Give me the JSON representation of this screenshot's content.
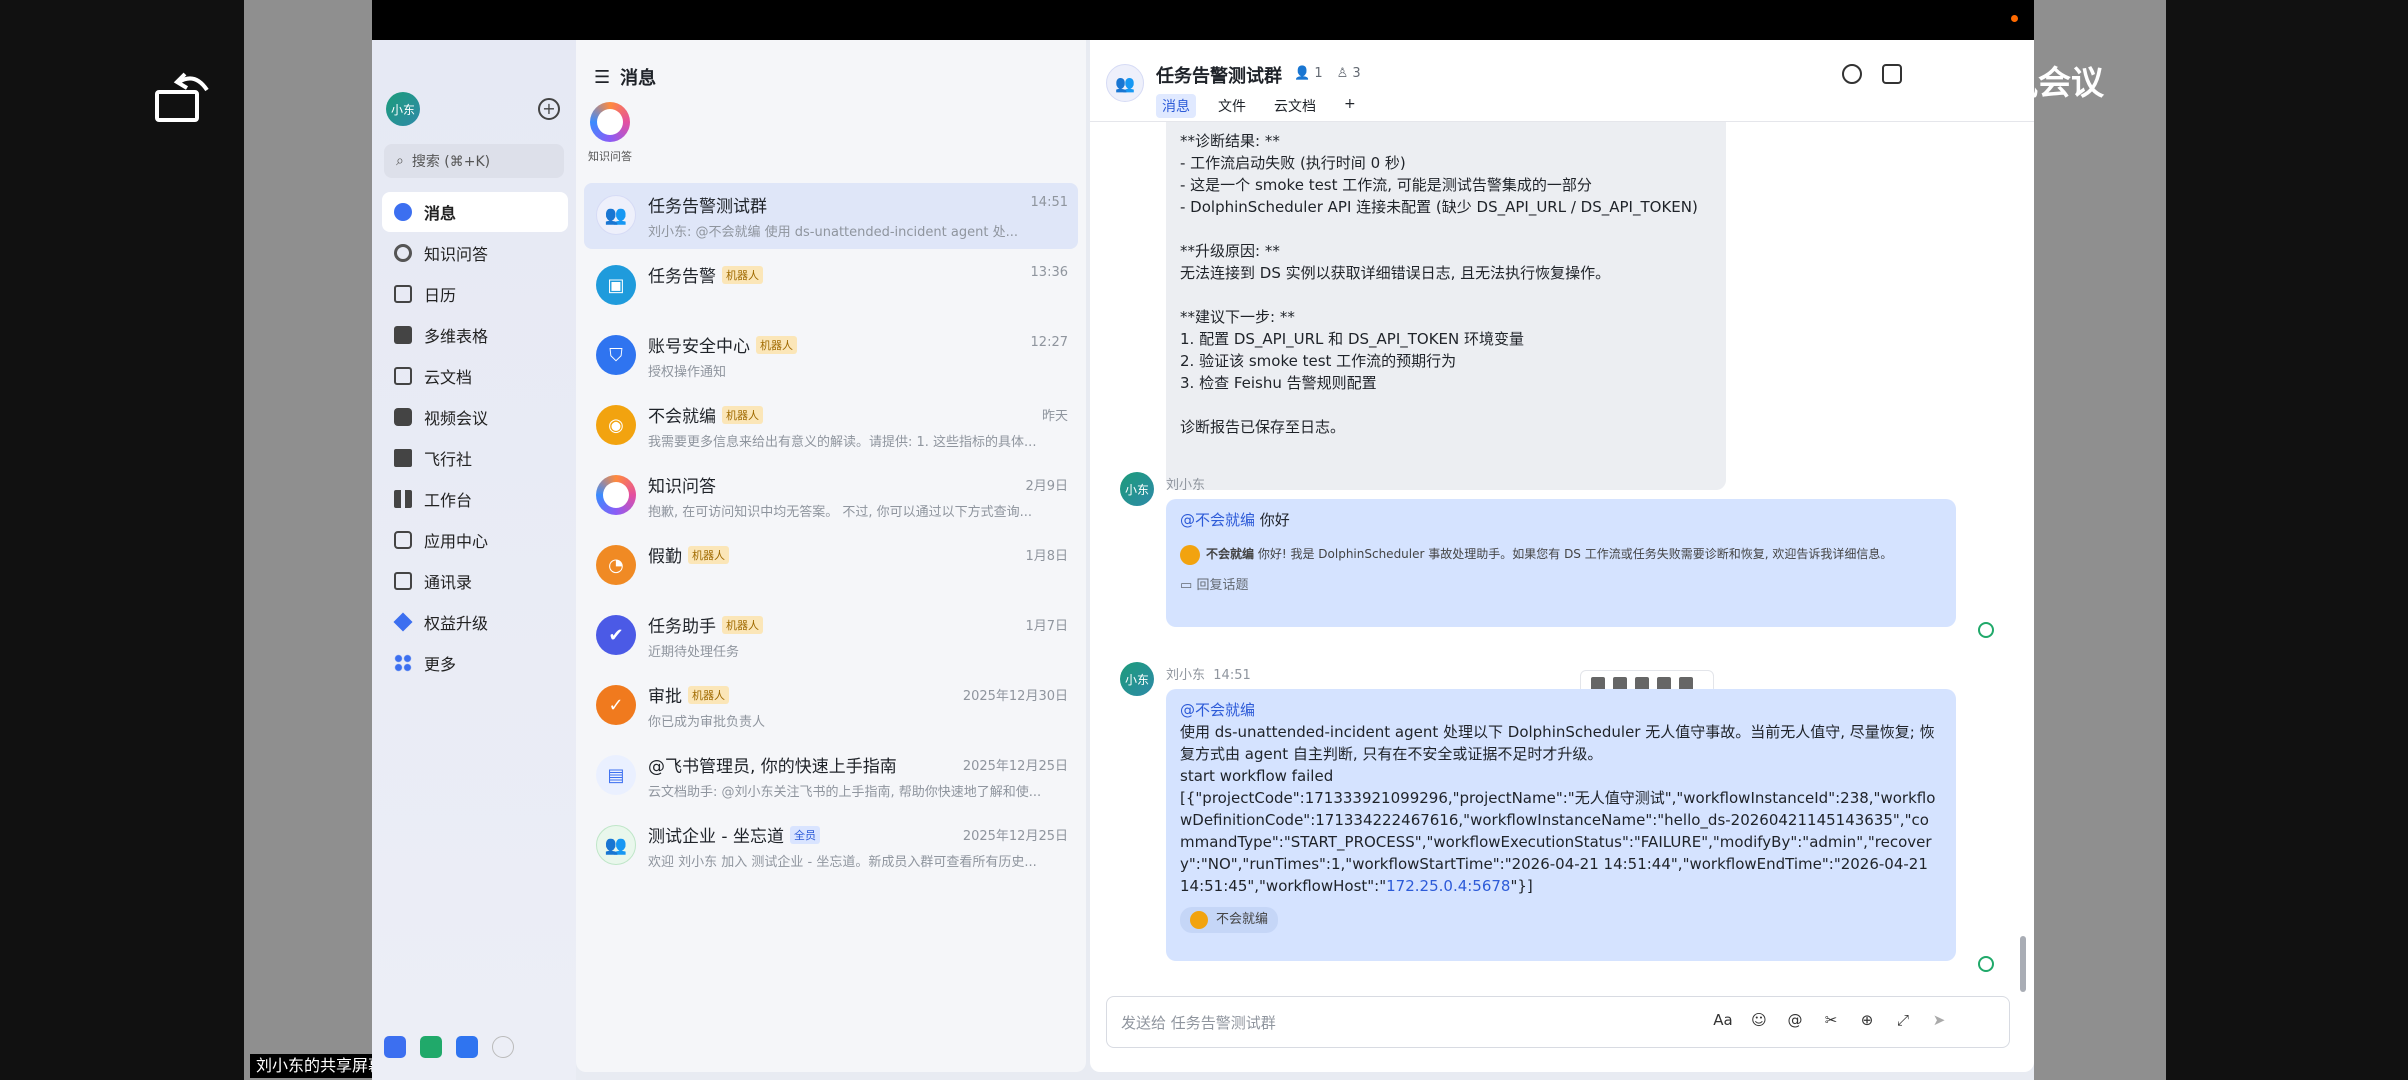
{
  "frame": {
    "share_label": "刘小东的共享屏幕",
    "meeting_brand": "腾讯会议",
    "accent": "#2d5bd8"
  },
  "nav": {
    "avatar": "小东",
    "search": "搜索 (⌘+K)",
    "items": [
      {
        "label": "消息",
        "icon": "message-icon",
        "active": true
      },
      {
        "label": "知识问答",
        "icon": "knowledge-icon"
      },
      {
        "label": "日历",
        "icon": "calendar-icon"
      },
      {
        "label": "多维表格",
        "icon": "table-icon"
      },
      {
        "label": "云文档",
        "icon": "doc-icon"
      },
      {
        "label": "视频会议",
        "icon": "video-icon"
      },
      {
        "label": "飞行社",
        "icon": "plane-icon"
      },
      {
        "label": "工作台",
        "icon": "grid-icon"
      },
      {
        "label": "应用中心",
        "icon": "apps-icon"
      },
      {
        "label": "通讯录",
        "icon": "contacts-icon"
      },
      {
        "label": "权益升级",
        "icon": "diamond-icon"
      },
      {
        "label": "更多",
        "icon": "more-icon"
      }
    ]
  },
  "list": {
    "header": "消息",
    "knowledge_label": "知识问答",
    "conversations": [
      {
        "name": "任务告警测试群",
        "time": "14:51",
        "preview": "刘小东: @不会就编 使用 ds-unattended-incident agent 处...",
        "badge": "",
        "color": "#eef0fb",
        "selected": true
      },
      {
        "name": "任务告警",
        "time": "13:36",
        "preview": "",
        "badge": "机器人",
        "color": "#1f9bdc"
      },
      {
        "name": "账号安全中心",
        "time": "12:27",
        "preview": "授权操作通知",
        "badge": "机器人",
        "color": "#2f74f0"
      },
      {
        "name": "不会就编",
        "time": "昨天",
        "preview": "我需要更多信息来给出有意义的解读。请提供: 1. 这些指标的具体...",
        "badge": "机器人",
        "color": "#f2a30f"
      },
      {
        "name": "知识问答",
        "time": "2月9日",
        "preview": "抱歉, 在可访问知识中均无答案。 不过, 你可以通过以下方式查询...",
        "badge": "",
        "color": "#a86ff2"
      },
      {
        "name": "假勤",
        "time": "1月8日",
        "preview": "",
        "badge": "机器人",
        "color": "#f08a24"
      },
      {
        "name": "任务助手",
        "time": "1月7日",
        "preview": "近期待处理任务",
        "badge": "机器人",
        "color": "#4b5ae6"
      },
      {
        "name": "审批",
        "time": "2025年12月30日",
        "preview": "你已成为审批负责人",
        "badge": "机器人",
        "color": "#f07a1e"
      },
      {
        "name": "@飞书管理员, 你的快速上手指南",
        "time": "2025年12月25日",
        "preview": "云文档助手: @刘小东关注飞书的上手指南, 帮助你快速地了解和使...",
        "badge": "",
        "color": "#3c6ff0"
      },
      {
        "name": "测试企业 - 坐忘道",
        "time": "2025年12月25日",
        "preview": "欢迎 刘小东 加入 测试企业 - 坐忘道。新成员入群可查看所有历史...",
        "badge": "全员",
        "color": "#e9f7ec"
      }
    ]
  },
  "chat": {
    "title": "任务告警测试群",
    "members": "1",
    "bots": "3",
    "tabs": [
      "消息",
      "文件",
      "云文档",
      "+"
    ],
    "report_text": "**诊断结果: **\n- 工作流启动失败 (执行时间 0 秒)\n- 这是一个 smoke test 工作流, 可能是测试告警集成的一部分\n- DolphinScheduler API 连接未配置 (缺少 DS_API_URL / DS_API_TOKEN)\n\n**升级原因: **\n无法连接到 DS 实例以获取详细错误日志, 且无法执行恢复操作。\n\n**建议下一步: **\n1. 配置 DS_API_URL 和 DS_API_TOKEN 环境变量\n2. 验证该 smoke test 工作流的预期行为\n3. 检查 Feishu 告警规则配置\n\n诊断报告已保存至日志。",
    "msg1": {
      "sender": "刘小东",
      "avatar": "小东",
      "mention": "@不会就编",
      "text": "你好",
      "reply_name": "不会就编",
      "reply_text": "你好! 我是 DolphinScheduler 事故处理助手。如果您有 DS 工作流或任务失败需要诊断和恢复, 欢迎告诉我详细信息。",
      "reply_link": "回复话题"
    },
    "msg2": {
      "sender": "刘小东",
      "time": "14:51",
      "avatar": "小东",
      "mention": "@不会就编",
      "body": "使用 ds-unattended-incident agent 处理以下 DolphinScheduler 无人值守事故。当前无人值守, 尽量恢复; 恢复方式由 agent 自主判断, 只有在不安全或证据不足时才升级。\nstart workflow failed\n[{\"projectCode\":171333921099296,\"projectName\":\"无人值守测试\",\"workflowInstanceId\":238,\"workflowDefinitionCode\":171334222467616,\"workflowInstanceName\":\"hello_ds-20260421145143635\",\"commandType\":\"START_PROCESS\",\"workflowExecutionStatus\":\"FAILURE\",\"modifyBy\":\"admin\",\"recovery\":\"NO\",\"runTimes\":1,\"workflowStartTime\":\"2026-04-21 14:51:44\",\"workflowEndTime\":\"2026-04-21 14:51:45\",\"workflowHost\":\"",
      "host": "172.25.0.4:5678",
      "tail": "\"}]",
      "reaction": "不会就编"
    },
    "composer_placeholder": "发送给 任务告警测试群",
    "composer_font_label": "Aa"
  }
}
